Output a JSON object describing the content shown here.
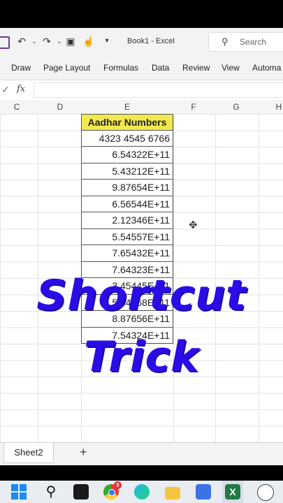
{
  "titlebar": {
    "undo_icon": "undo-icon",
    "redo_icon": "redo-icon",
    "doc_title": "Book1  -  Excel",
    "search_placeholder": "Search"
  },
  "ribbon": {
    "tabs": [
      "Draw",
      "Page Layout",
      "Formulas",
      "Data",
      "Review",
      "View",
      "Automa"
    ]
  },
  "formula_bar": {
    "check": "✓",
    "fx": "fx",
    "value": ""
  },
  "columns": [
    "C",
    "D",
    "E",
    "F",
    "G",
    "H"
  ],
  "sheet": {
    "header": "Aadhar Numbers",
    "values": [
      "4323 4545 6766",
      "6.54322E+11",
      "5.43212E+11",
      "9.87654E+11",
      "6.56544E+11",
      "2.12346E+11",
      "5.54557E+11",
      "7.65432E+11",
      "7.64323E+11",
      "3.45445E+11",
      "5.44568E+11",
      "8.87656E+11",
      "7.54324E+11"
    ],
    "header_color": "#f2e94e"
  },
  "overlay": {
    "line1": "Shortcut",
    "line2": "Trick",
    "color": "#2a0de6"
  },
  "sheet_tabs": {
    "active": "Sheet2",
    "add": "+"
  },
  "taskbar": {
    "notification_count": "8",
    "excel_letter": "X"
  }
}
